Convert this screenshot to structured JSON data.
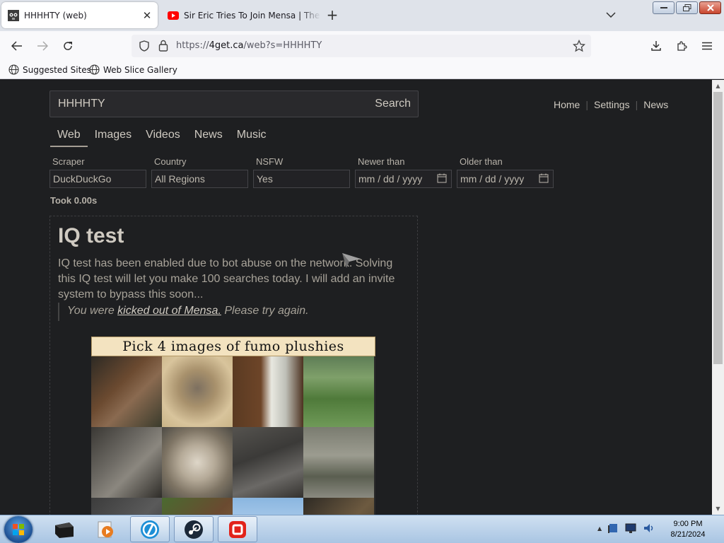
{
  "browser": {
    "tabs": [
      {
        "title": "HHHHTY (web)",
        "favicon": "4get-favicon",
        "active": true
      },
      {
        "title": "Sir Eric Tries To Join Mensa | The",
        "favicon": "youtube-favicon",
        "active": false
      }
    ],
    "url_prefix": "https://",
    "url_host": "4get.ca",
    "url_path": "/web?s=HHHHTY",
    "bookmarks": [
      "Suggested Sites",
      "Web Slice Gallery"
    ]
  },
  "search": {
    "query": "HHHHTY",
    "button": "Search"
  },
  "top_links": [
    "Home",
    "Settings",
    "News"
  ],
  "nav_tabs": [
    {
      "label": "Web",
      "active": true
    },
    {
      "label": "Images"
    },
    {
      "label": "Videos"
    },
    {
      "label": "News"
    },
    {
      "label": "Music"
    }
  ],
  "filters": [
    {
      "label": "Scraper",
      "value": "DuckDuckGo"
    },
    {
      "label": "Country",
      "value": "All Regions"
    },
    {
      "label": "NSFW",
      "value": "Yes"
    },
    {
      "label": "Newer than",
      "value": "mm / dd / yyyy"
    },
    {
      "label": "Older than",
      "value": "mm / dd / yyyy"
    }
  ],
  "took": "Took 0.00s",
  "iq_test": {
    "heading": "IQ test",
    "description": "IQ test has been enabled due to bot abuse on the network. Solving this IQ test will let you make 100 searches today. I will add an invite system to bypass this soon...",
    "quote_prefix": "You were ",
    "quote_link": "kicked out of Mensa.",
    "quote_suffix": " Please try again.",
    "captcha_title": "Pick 4 images of fumo plushies"
  },
  "taskbar": {
    "time": "9:00 PM",
    "date": "8/21/2024"
  },
  "colors": {
    "page_background": "#1e1f21",
    "text": "#bdb8ae",
    "captcha_header": "#f3e3c0"
  }
}
